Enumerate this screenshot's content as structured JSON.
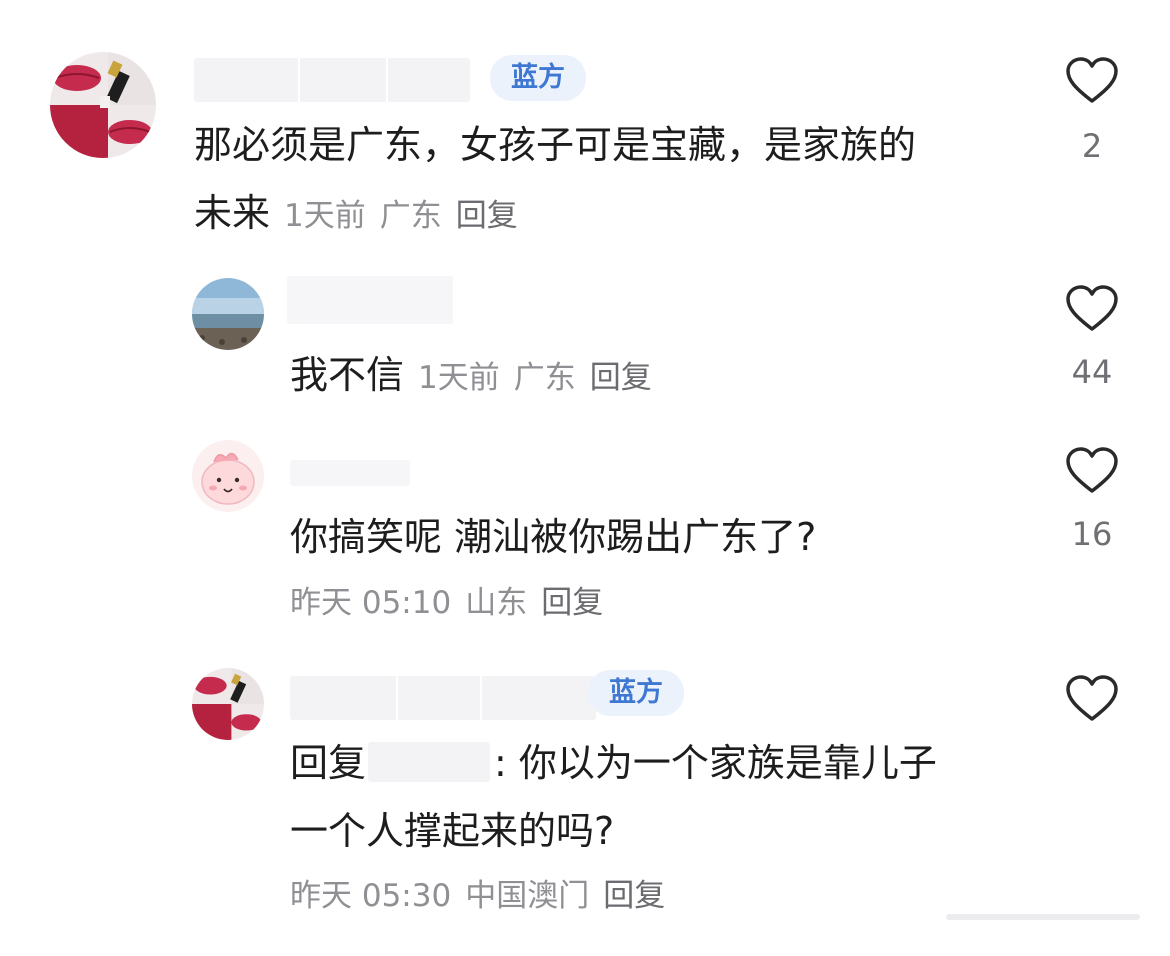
{
  "badge_label": "蓝方",
  "comments": [
    {
      "text_line1": "那必须是广东，女孩子可是宝藏，是家族的",
      "text_line2": "未来",
      "time": "1天前",
      "location": "广东",
      "reply": "回复",
      "likes": "2"
    },
    {
      "text": "我不信",
      "time": "1天前",
      "location": "广东",
      "reply": "回复",
      "likes": "44"
    },
    {
      "text": "你搞笑呢 潮汕被你踢出广东了?",
      "time": "昨天 05:10",
      "location": "山东",
      "reply": "回复",
      "likes": "16"
    },
    {
      "reply_prefix": "回复",
      "text_line1": ": 你以为一个家族是靠儿子",
      "text_line2": "一个人撑起来的吗?",
      "time": "昨天 05:30",
      "location": "中国澳门",
      "reply": "回复"
    }
  ],
  "colors": {
    "badge_text": "#3f78d2",
    "badge_bg": "#ecf2fc",
    "meta_text": "#8f8f94",
    "heart_stroke": "#2a2a2a"
  },
  "icons": [
    "heart-outline-icon"
  ]
}
